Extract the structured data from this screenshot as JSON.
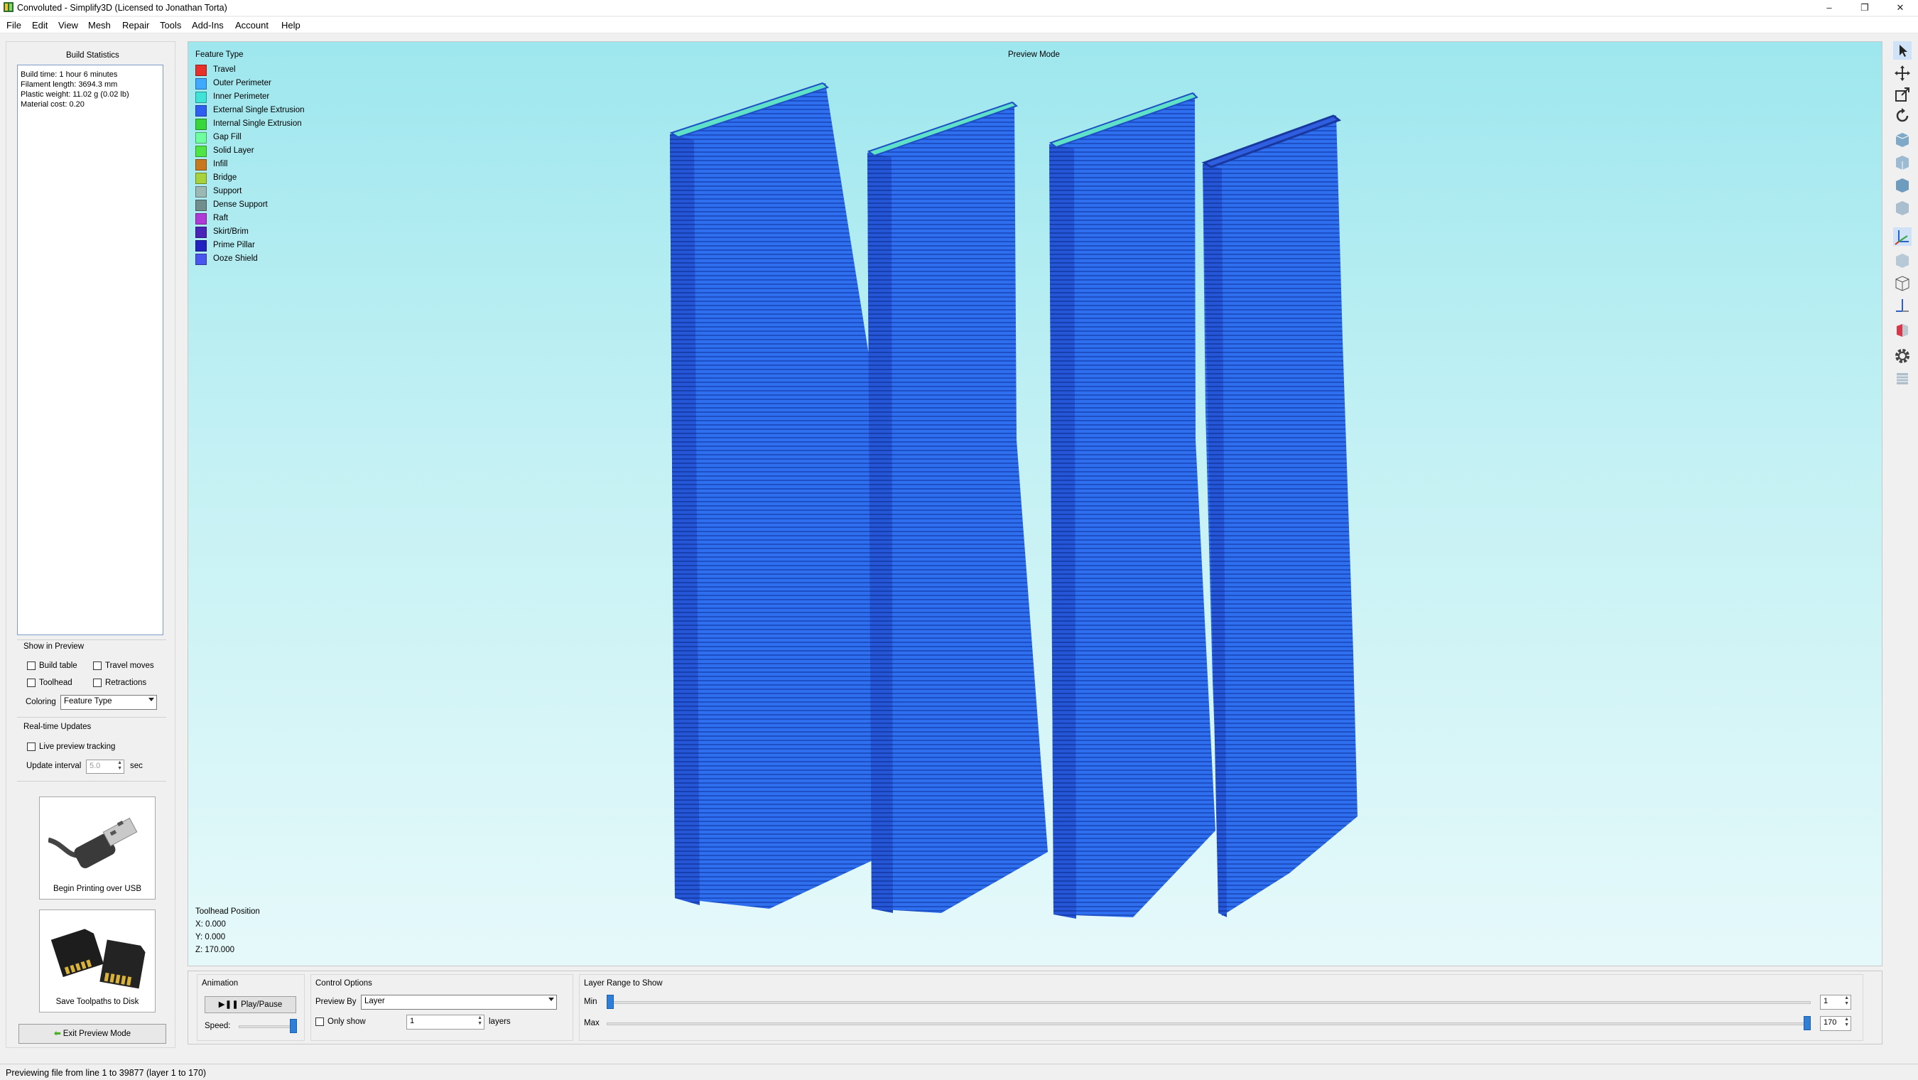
{
  "window": {
    "title": "Convoluted - Simplify3D (Licensed to Jonathan Torta)",
    "controls": [
      "–",
      "❐",
      "✕"
    ]
  },
  "menu": [
    "File",
    "Edit",
    "View",
    "Mesh",
    "Repair",
    "Tools",
    "Add-Ins",
    "Account",
    "Help"
  ],
  "left_panel": {
    "build_stats_title": "Build Statistics",
    "stats": [
      "Build time: 1 hour 6 minutes",
      "Filament length: 3694.3 mm",
      "Plastic weight: 11.02 g (0.02 lb)",
      "Material cost: 0.20"
    ],
    "show_in_preview_title": "Show in Preview",
    "build_table": "Build table",
    "travel_moves": "Travel moves",
    "toolhead": "Toolhead",
    "retractions": "Retractions",
    "coloring_label": "Coloring",
    "coloring_value": "Feature Type",
    "realtime_title": "Real-time Updates",
    "live_preview": "Live preview tracking",
    "update_interval_label": "Update interval",
    "update_interval_value": "5.0",
    "update_interval_unit": "sec",
    "usb_button": "Begin Printing over USB",
    "sd_button": "Save Toolpaths to Disk",
    "exit_button": "Exit Preview Mode"
  },
  "viewport": {
    "mode": "Preview Mode",
    "legend_title": "Feature Type",
    "legend": [
      {
        "label": "Travel",
        "color": "#e8302a"
      },
      {
        "label": "Outer Perimeter",
        "color": "#3fa8ff"
      },
      {
        "label": "Inner Perimeter",
        "color": "#3fe3d8"
      },
      {
        "label": "External Single Extrusion",
        "color": "#2f5ff0"
      },
      {
        "label": "Internal Single Extrusion",
        "color": "#38d63a"
      },
      {
        "label": "Gap Fill",
        "color": "#6dffa0"
      },
      {
        "label": "Solid Layer",
        "color": "#4fe645"
      },
      {
        "label": "Infill",
        "color": "#c8781e"
      },
      {
        "label": "Bridge",
        "color": "#a8d23a"
      },
      {
        "label": "Support",
        "color": "#9cb8b4"
      },
      {
        "label": "Dense Support",
        "color": "#6f8e8c"
      },
      {
        "label": "Raft",
        "color": "#b03ad8"
      },
      {
        "label": "Skirt/Brim",
        "color": "#4a23b8"
      },
      {
        "label": "Prime Pillar",
        "color": "#2222c0"
      },
      {
        "label": "Ooze Shield",
        "color": "#4a55f0"
      }
    ],
    "toolhead_title": "Toolhead Position",
    "toolhead_x": "X: 0.000",
    "toolhead_y": "Y: 0.000",
    "toolhead_z": "Z: 170.000",
    "part_color": "#2e6ff0",
    "part_top_color": "#5fe0c8"
  },
  "right_toolbar": [
    "select-icon",
    "move-icon",
    "scale-icon",
    "rotate-icon",
    "view-cube-icon",
    "view-cube-icon",
    "view-cube-icon",
    "view-cube-icon",
    "axes-icon",
    "solid-cube-icon",
    "wireframe-cube-icon",
    "build-axis-icon",
    "cross-section-icon",
    "settings-gear-icon",
    "toolpath-layers-icon"
  ],
  "bottom_panel": {
    "animation_title": "Animation",
    "play_pause": "Play/Pause",
    "speed_label": "Speed:",
    "speed": 1.0,
    "control_title": "Control Options",
    "preview_by_label": "Preview By",
    "preview_by_value": "Layer",
    "only_show": "Only show",
    "only_show_value": "1",
    "layers_label": "layers",
    "layer_range_title": "Layer Range to Show",
    "min_label": "Min",
    "min_value": "1",
    "max_label": "Max",
    "max_value": "170",
    "min_fraction": 0.0,
    "max_fraction": 1.0
  },
  "status_text": "Previewing file from line 1 to 39877 (layer 1 to 170)"
}
